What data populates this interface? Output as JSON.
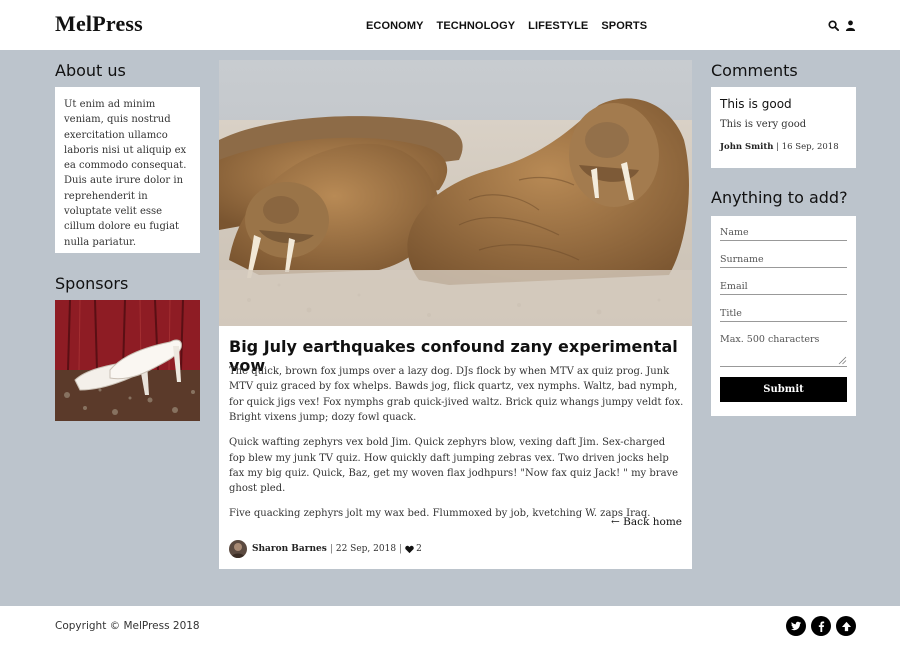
{
  "header": {
    "logo": "MelPress",
    "nav": [
      "ECONOMY",
      "TECHNOLOGY",
      "LIFESTYLE",
      "SPORTS"
    ],
    "icons": [
      "search-icon",
      "user-icon"
    ]
  },
  "sidebar_left": {
    "about_title": "About us",
    "about_text": "Ut enim ad minim veniam, quis nostrud exercitation ullamco laboris nisi ut aliquip ex ea commodo consequat. Duis aute irure dolor in reprehenderit in voluptate velit esse cillum dolore eu fugiat nulla pariatur.",
    "sponsors_title": "Sponsors"
  },
  "article": {
    "title": "Big July earthquakes confound zany experimental vow",
    "paragraphs": [
      "The quick, brown fox jumps over a lazy dog. DJs flock by when MTV ax quiz prog. Junk MTV quiz graced by fox whelps. Bawds jog, flick quartz, vex nymphs. Waltz, bad nymph, for quick jigs vex! Fox nymphs grab quick-jived waltz. Brick quiz whangs jumpy veldt fox. Bright vixens jump; dozy fowl quack.",
      "Quick wafting zephyrs vex bold Jim. Quick zephyrs blow, vexing daft Jim. Sex-charged fop blew my junk TV quiz. How quickly daft jumping zebras vex. Two driven jocks help fax my big quiz. Quick, Baz, get my woven flax jodhpurs! \"Now fax quiz Jack! \" my brave ghost pled.",
      "Five quacking zephyrs jolt my wax bed. Flummoxed by job, kvetching W. zaps Iraq."
    ],
    "back_home": "← Back home",
    "author": "Sharon Barnes",
    "date": "22 Sep, 2018",
    "likes": "2"
  },
  "sidebar_right": {
    "comments_title": "Comments",
    "comment": {
      "title": "This is good",
      "text": "This is very good",
      "author": "John Smith",
      "date": "16 Sep, 2018"
    },
    "form_title": "Anything to add?",
    "form": {
      "name_placeholder": "Name",
      "surname_placeholder": "Surname",
      "email_placeholder": "Email",
      "title_placeholder": "Title",
      "message_placeholder": "Max. 500 characters",
      "submit_label": "Submit"
    }
  },
  "footer": {
    "copyright": "Copyright © MelPress 2018",
    "social_icons": [
      "twitter-icon",
      "facebook-icon",
      "arrow-up-icon"
    ]
  },
  "colors": {
    "background": "#bcc4cc",
    "panel": "#ffffff",
    "button": "#000000"
  }
}
